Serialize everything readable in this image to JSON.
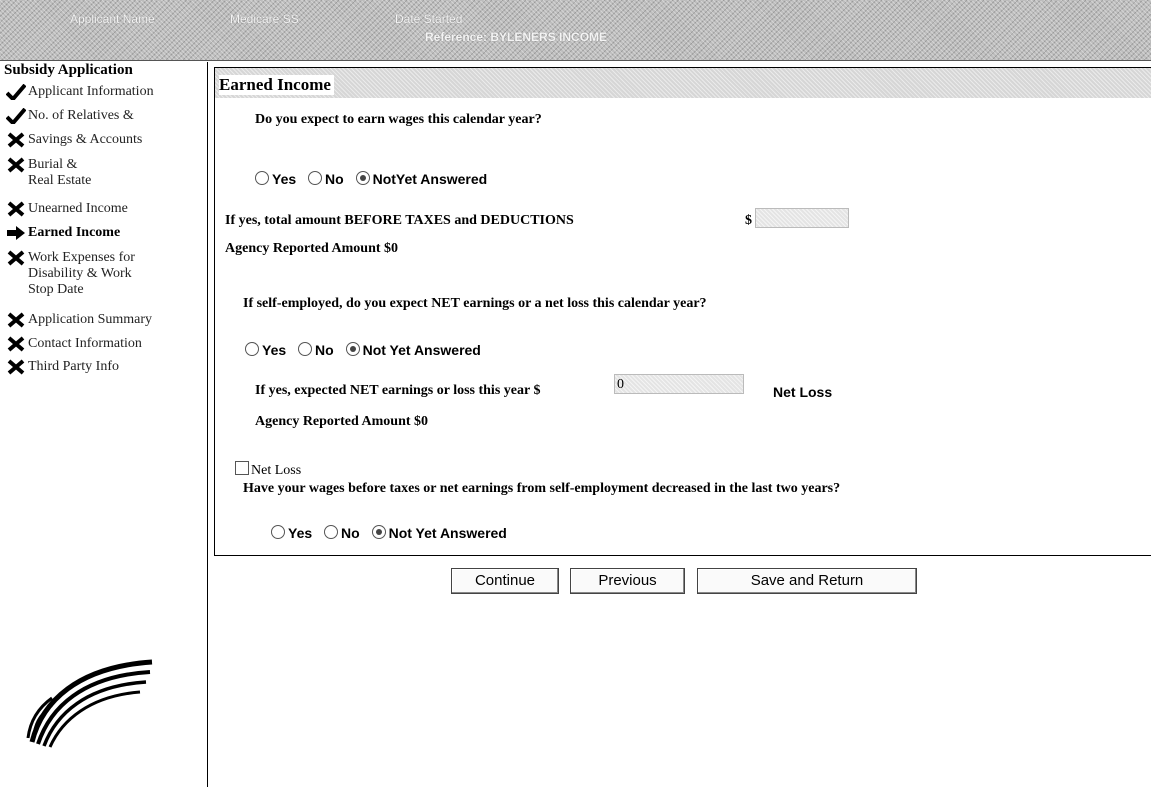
{
  "header": {
    "col1": "Applicant Name",
    "col2": "Medicare SS",
    "col3": "Date Started",
    "col4": "Reference: BYLENERS INCOME"
  },
  "sidebar": {
    "title": "Subsidy Application",
    "items": [
      {
        "label": "Applicant Information",
        "status": "check-icon"
      },
      {
        "label": "No. of Relatives &",
        "status": "check-icon"
      },
      {
        "label": "Savings & Accounts",
        "status": "x-icon"
      },
      {
        "label": "Burial &",
        "label2": "Real Estate",
        "status": "x-icon"
      },
      {
        "label": "Unearned Income",
        "status": "x-icon"
      },
      {
        "label": "Earned Income",
        "status": "arrow-icon"
      },
      {
        "label": "Work Expenses for",
        "label2": "Disability & Work",
        "label3": "Stop Date",
        "status": "x-icon"
      },
      {
        "label": "Application Summary",
        "status": "x-icon"
      },
      {
        "label": "Contact Information",
        "status": "x-icon"
      },
      {
        "label": "Third Party Info",
        "status": "x-icon"
      }
    ]
  },
  "panel": {
    "title": "Earned Income",
    "q1": "Do you expect to earn wages this calendar year?",
    "q1_options": [
      "Yes",
      "No",
      "NotYet Answered"
    ],
    "q1_amount_label": "If yes, total amount BEFORE TAXES and DEDUCTIONS",
    "q1_currency": "$",
    "q1_amount_value": "",
    "q1_agency": "Agency Reported Amount $0",
    "q2": "If self-employed, do you  expect NET earnings or a net loss this calendar year?",
    "q2_options": [
      "Yes",
      "No",
      "Not Yet Answered"
    ],
    "q2_amount_label": "If yes, expected NET earnings or loss this year $",
    "q2_amount_value": "0",
    "q2_netloss_label": "Net Loss",
    "q2_agency": "Agency Reported Amount $0",
    "netloss_checkbox_label": "Net Loss",
    "q3": "Have your wages before taxes or net earnings from self-employment decreased in the last two years?",
    "q3_options": [
      "Yes",
      "No",
      "Not Yet Answered"
    ]
  },
  "buttons": {
    "continue": "Continue",
    "previous": "Previous",
    "save_return": "Save and Return"
  }
}
